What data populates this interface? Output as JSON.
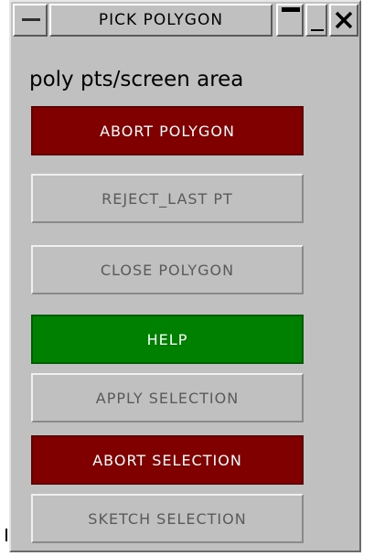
{
  "window": {
    "title": "PICK POLYGON"
  },
  "icons": {
    "menu": "window-menu-icon",
    "minimize": "minimize-icon",
    "restore": "restore-icon",
    "close": "close-icon"
  },
  "panel": {
    "subtitle": "poly pts/screen area",
    "buttons": {
      "abort_polygon": "ABORT POLYGON",
      "reject_last_pt": "REJECT_LAST PT",
      "close_polygon": "CLOSE POLYGON",
      "help": "HELP",
      "apply_selection": "APPLY SELECTION",
      "abort_selection": "ABORT SELECTION",
      "sketch_selection": "SKETCH SELECTION"
    }
  },
  "colors": {
    "panel_bg": "#c0c0c0",
    "abort_red": "#800000",
    "help_green": "#008000",
    "disabled_text": "#5a5a5a"
  }
}
